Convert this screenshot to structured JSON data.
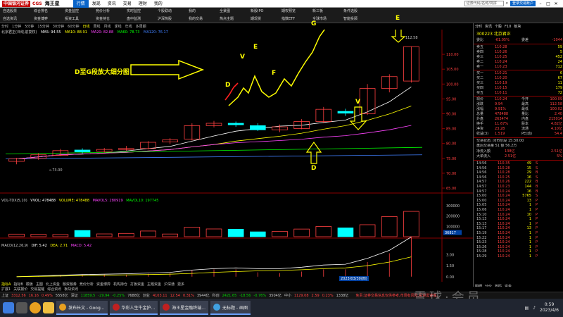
{
  "titlebar": {
    "logo_badge": "中国银河证券",
    "logo_code": "CGS",
    "brand": "海王星",
    "menus": [
      "行情",
      "发现",
      "资讯",
      "交易",
      "理财",
      "我的"
    ],
    "active_menu": "行情",
    "search_placeholder": "证券代码/名称/简拼",
    "login_label": "登录交易账户"
  },
  "ribbon": [
    [
      "自选股票",
      "自选资讯"
    ],
    [
      "综合排名",
      "资金博弈"
    ],
    [
      "资金监控",
      "投资工具"
    ],
    [
      "竞价分析",
      "资金持仓"
    ],
    [
      "实时监控",
      "盘中监测"
    ],
    [
      "个股联动",
      "沪深热股"
    ],
    [
      "我的",
      "我的交易"
    ],
    [
      "全景图",
      "热点主题"
    ],
    [
      "新股IPO",
      "期现货"
    ],
    [
      "期权预览",
      "指数ETF"
    ],
    [
      "新三板",
      "全球市场"
    ],
    [
      "条件选股",
      "智能投顾"
    ]
  ],
  "chart_toolbar": {
    "timeframes": [
      "分时",
      "1分钟",
      "5分钟",
      "15分钟",
      "30分钟",
      "60分钟",
      "日线",
      "周线",
      "月线",
      "季线",
      "年线",
      "多周期"
    ],
    "active": "日线"
  },
  "chart_title": {
    "name": "北京君正(日线,前复权)",
    "ma5": "MA5: 94.55",
    "ma10": "MA10: 88.91",
    "ma20": "MA20: 82.88",
    "ma60": "MA60: 78.73",
    "ma120": "MA120: 76.17"
  },
  "annotations": {
    "title": "D至G段放大细分图",
    "letters_zoom": [
      "D",
      "V",
      "E",
      "F",
      "G"
    ],
    "letter_top_e": "E",
    "letter_v": "V",
    "letter_d": "D"
  },
  "chart_labels": {
    "high_price": "112.58",
    "low_price": "73.00",
    "date": "2023/03/30(四)",
    "price_axis": [
      "110.00",
      "105.00",
      "100.00",
      "95.00",
      "90.00",
      "85.00",
      "80.00",
      "75.00",
      "70.00",
      "65.00"
    ],
    "vol_axis": [
      "300000",
      "200000",
      "100000"
    ],
    "vol_tag": "36817",
    "macd_axis": [
      "3.00",
      "1.50",
      "0.00"
    ]
  },
  "volume_title": {
    "name": "VOL-TDX(5,10)",
    "vvol": "VVOL: 478488",
    "volume": "VOLUME: 478488",
    "mavol5": "MAVOL5: 280919",
    "mavol10": "MAVOL10: 197745"
  },
  "macd_title": {
    "name": "MACD(12,26,9)",
    "dif": "DIF: 5.42",
    "dea": "DEA: 2.71",
    "macd": "MACD: 5.42"
  },
  "chart_data": {
    "type": "candlestick",
    "title": "北京君正(日线,前复权)",
    "annotated_points": [
      "D",
      "V",
      "E",
      "F",
      "G"
    ],
    "candles": [
      {
        "open": 74.0,
        "close": 74.8,
        "high": 75.2,
        "low": 73.0
      },
      {
        "open": 75.0,
        "close": 76.2,
        "high": 76.8,
        "low": 74.5
      },
      {
        "open": 76.0,
        "close": 77.6,
        "high": 78.2,
        "low": 75.8
      },
      {
        "open": 77.8,
        "close": 77.2,
        "high": 78.4,
        "low": 76.6
      },
      {
        "open": 77.4,
        "close": 78.0,
        "high": 78.5,
        "low": 76.9
      },
      {
        "open": 78.0,
        "close": 78.3,
        "high": 79.2,
        "low": 77.5
      },
      {
        "open": 78.3,
        "close": 80.4,
        "high": 80.8,
        "low": 78.0
      },
      {
        "open": 80.5,
        "close": 81.2,
        "high": 81.8,
        "low": 79.8
      },
      {
        "open": 81.5,
        "close": 86.0,
        "high": 86.8,
        "low": 81.0
      },
      {
        "open": 86.0,
        "close": 86.8,
        "high": 87.6,
        "low": 85.4
      },
      {
        "open": 86.8,
        "close": 86.3,
        "high": 87.4,
        "low": 85.6
      },
      {
        "open": 86.0,
        "close": 84.6,
        "high": 86.8,
        "low": 84.2
      },
      {
        "open": 84.6,
        "close": 85.6,
        "high": 86.4,
        "low": 83.8
      },
      {
        "open": 85.0,
        "close": 87.4,
        "high": 88.2,
        "low": 84.8
      },
      {
        "open": 87.4,
        "close": 91.5,
        "high": 92.3,
        "low": 86.8
      },
      {
        "open": 90.8,
        "close": 90.2,
        "high": 91.7,
        "low": 89.3
      },
      {
        "open": 90.0,
        "close": 98.5,
        "high": 100.0,
        "low": 89.6
      },
      {
        "open": 98.5,
        "close": 102.5,
        "high": 103.3,
        "low": 97.2
      },
      {
        "open": 101.0,
        "close": 112.58,
        "high": 112.58,
        "low": 100.5
      }
    ],
    "volume": [
      25000,
      23000,
      21000,
      60000,
      27000,
      32000,
      55000,
      26000,
      92000,
      75000,
      72000,
      47000,
      52000,
      74000,
      99000,
      85000,
      116000,
      195000,
      245000
    ],
    "macd_dif": [
      0.0,
      0.1,
      0.2,
      0.3,
      0.35,
      0.4,
      0.5,
      0.6,
      0.9,
      1.1,
      1.2,
      1.1,
      1.1,
      1.3,
      1.6,
      1.7,
      2.5,
      3.6,
      5.42
    ],
    "macd_dea": [
      0.0,
      0.05,
      0.1,
      0.15,
      0.2,
      0.25,
      0.3,
      0.35,
      0.45,
      0.6,
      0.7,
      0.8,
      0.85,
      0.95,
      1.1,
      1.2,
      1.5,
      2.0,
      2.71
    ],
    "ylim_price": [
      65,
      115
    ],
    "ylim_volume": [
      0,
      300000
    ],
    "ylim_macd": [
      -0.5,
      4.5
    ]
  },
  "quote_panel": {
    "head": [
      "分时",
      "资讯",
      "个股",
      "F10",
      "板块"
    ],
    "stock": "300223 北京君正",
    "wei_bi": {
      "label": "委比",
      "value": "-61.05%",
      "label2": "委差",
      "value2": "-1044"
    },
    "asks": [
      {
        "label": "卖五",
        "price": "110.28",
        "vol": "59"
      },
      {
        "label": "卖四",
        "price": "110.26",
        "vol": "5"
      },
      {
        "label": "卖三",
        "price": "110.25",
        "vol": "452"
      },
      {
        "label": "卖二",
        "price": "110.24",
        "vol": "24"
      },
      {
        "label": "卖一",
        "price": "110.23",
        "vol": "712"
      }
    ],
    "bids": [
      {
        "label": "买一",
        "price": "110.21",
        "vol": "6"
      },
      {
        "label": "买二",
        "price": "110.20",
        "vol": "67"
      },
      {
        "label": "买三",
        "price": "110.19",
        "vol": "11"
      },
      {
        "label": "买四",
        "price": "110.15",
        "vol": "179"
      },
      {
        "label": "买五",
        "price": "110.11",
        "vol": "72"
      }
    ],
    "stats": [
      {
        "l": "现价",
        "v": "110.24",
        "l2": "今开",
        "v2": "100.09"
      },
      {
        "l": "涨跌",
        "v": "9.94",
        "l2": "最高",
        "v2": "112.58"
      },
      {
        "l": "涨幅",
        "v": "9.91%",
        "l2": "最低",
        "v2": "100.02"
      },
      {
        "l": "总量",
        "v": "478488",
        "l2": "量比",
        "v2": "2.40"
      },
      {
        "l": "外盘",
        "v": "263474",
        "l2": "内盘",
        "v2": "215014"
      },
      {
        "l": "换手",
        "v": "11.67%",
        "l2": "股本",
        "v2": "4.82亿"
      },
      {
        "l": "净资",
        "v": "23.28",
        "l2": "流通",
        "v2": "4.10亿"
      },
      {
        "l": "收益(3)",
        "v": "1.519",
        "l2": "PE(动)",
        "v2": "54.4"
      }
    ],
    "info": [
      "交易状态: 闭市阶段 15:30:00",
      "盘后交易量 51 额 56.2万"
    ],
    "flows": [
      {
        "l": "净流入额",
        "v1": "138亿",
        "v2": "2.51亿"
      },
      {
        "l": "大单流入",
        "v1": "2.51亿",
        "v2": "5%"
      }
    ],
    "ticks": [
      {
        "t": "14:56",
        "p": "110.35",
        "v": "49",
        "b": "S"
      },
      {
        "t": "14:56",
        "p": "110.28",
        "v": "15",
        "b": "S"
      },
      {
        "t": "14:56",
        "p": "110.28",
        "v": "29",
        "b": "B"
      },
      {
        "t": "14:56",
        "p": "110.25",
        "v": "16",
        "b": "S"
      },
      {
        "t": "14:57",
        "p": "110.26",
        "v": "222",
        "b": "B"
      },
      {
        "t": "14:57",
        "p": "110.23",
        "v": "144",
        "b": "B"
      },
      {
        "t": "14:57",
        "p": "110.24",
        "v": "16",
        "b": "B"
      },
      {
        "t": "15:00",
        "p": "110.24",
        "v": "5765",
        "b": "S"
      },
      {
        "t": "15:00",
        "p": "110.24",
        "v": "13",
        "b": "P"
      },
      {
        "t": "15:05",
        "p": "110.24",
        "v": "1",
        "b": "P"
      },
      {
        "t": "15:06",
        "p": "110.24",
        "v": "1",
        "b": "P"
      },
      {
        "t": "15:10",
        "p": "110.24",
        "v": "10",
        "b": "P"
      },
      {
        "t": "15:13",
        "p": "110.24",
        "v": "1",
        "b": "P"
      },
      {
        "t": "15:13",
        "p": "110.24",
        "v": "1",
        "b": "P"
      },
      {
        "t": "15:17",
        "p": "110.24",
        "v": "13",
        "b": "P"
      },
      {
        "t": "15:19",
        "p": "110.24",
        "v": "1",
        "b": "P"
      },
      {
        "t": "15:22",
        "p": "110.24",
        "v": "1",
        "b": "P"
      },
      {
        "t": "15:23",
        "p": "110.24",
        "v": "1",
        "b": "P"
      },
      {
        "t": "15:26",
        "p": "110.24",
        "v": "1",
        "b": "P"
      },
      {
        "t": "15:28",
        "p": "110.24",
        "v": "1",
        "b": "P"
      },
      {
        "t": "15:29",
        "p": "110.24",
        "v": "1",
        "b": "P"
      }
    ],
    "bottom_tabs": [
      "明细",
      "分价",
      "筹码",
      "资金"
    ]
  },
  "bottom_tabs": {
    "items": [
      "指标A",
      "指标B",
      "模板",
      "主图",
      "北上资金",
      "融资融券",
      "竞价分析",
      "资金博弈",
      "机构持仓",
      "打板资金",
      "主题资金",
      "沪深通",
      "更多"
    ],
    "active": "指标A"
  },
  "bottom_tabs2": [
    "扩展1",
    "关联报价",
    "交易提醒",
    "综合资讯",
    "板块资讯"
  ],
  "index_bar": {
    "items": [
      {
        "name": "上证",
        "val": "3312.56",
        "chg": "16.16",
        "pct": "0.49%",
        "amt": "5558亿",
        "up": true
      },
      {
        "name": "深证",
        "val": "11859.5",
        "chg": "-29.94",
        "pct": "-0.25%",
        "amt": "7688亿",
        "up": false
      },
      {
        "name": "创业",
        "val": "4103.11",
        "chg": "12.54",
        "pct": "0.31%",
        "amt": "3944亿",
        "up": true
      },
      {
        "name": "科创",
        "val": "2421.65",
        "chg": "-18.56",
        "pct": "-0.76%",
        "amt": "3504亿",
        "up": false
      },
      {
        "name": "中小",
        "val": "1129.08",
        "chg": "2.59",
        "pct": "0.23%",
        "amt": "1338亿",
        "up": true
      }
    ],
    "news": "免责:证券交易信息仅供参考,市场有风险,投资需谨慎。"
  },
  "taskbar": {
    "apps": [
      "发布长文 - Goog...",
      "华彩人生牛金护...",
      "海王星金融终端...",
      "无标题 - 画图"
    ],
    "time": "0:59",
    "date": "2023/4/6",
    "watermark": "雪球·会员"
  },
  "colors": {
    "up": "#ff4040",
    "down": "#00ffff",
    "ma5": "#ffffff",
    "ma10": "#ffff00",
    "ma20": "#ff44ff",
    "ma60": "#00ff00",
    "ma120": "#4080ff",
    "annotation": "#ffff00"
  }
}
